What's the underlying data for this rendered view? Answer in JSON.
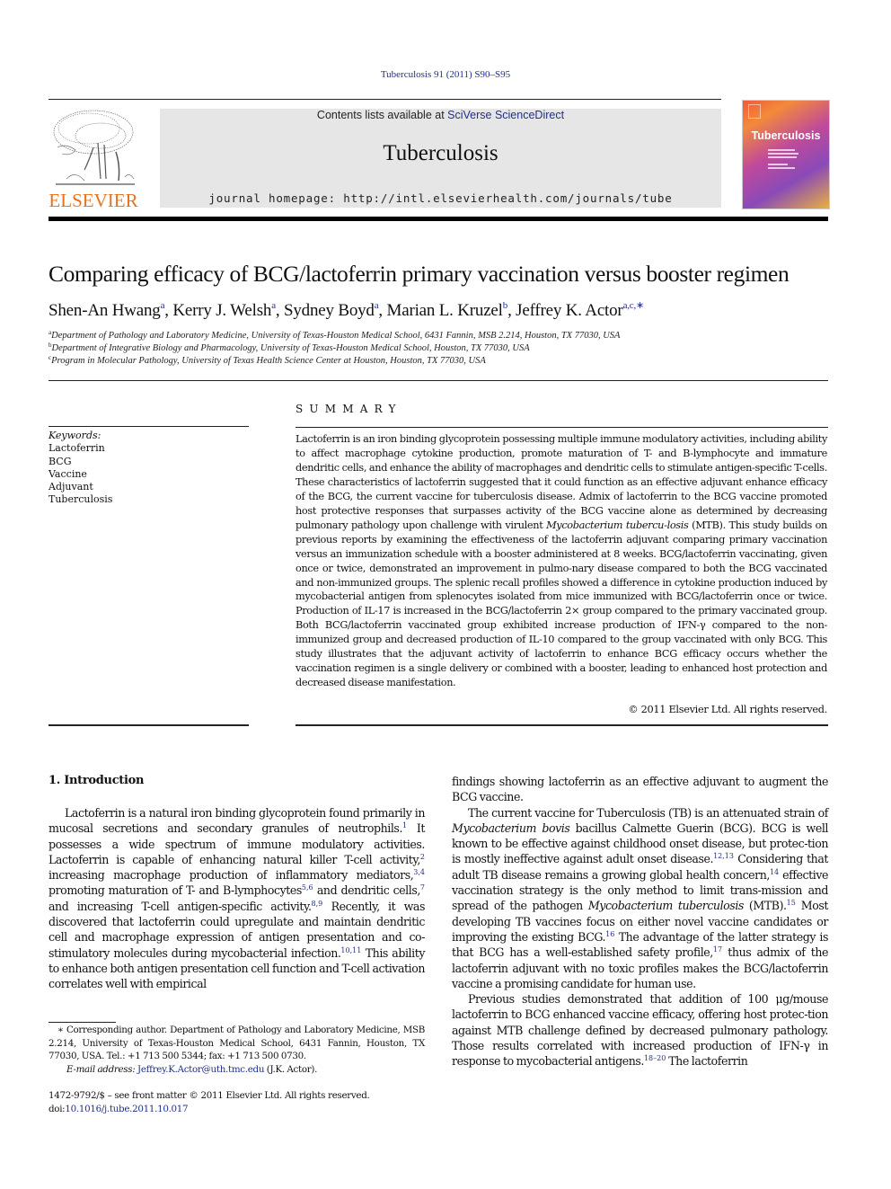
{
  "journal_ref": "Tuberculosis 91 (2011) S90–S95",
  "masthead": {
    "contents_prefix": "Contents lists available at ",
    "contents_link": "SciVerse ScienceDirect",
    "journal_title": "Tuberculosis",
    "homepage": "journal homepage: http://intl.elsevierhealth.com/journals/tube",
    "publisher": "ELSEVIER",
    "cover_title": "Tuberculosis"
  },
  "colors": {
    "link": "#1f2f8a",
    "elsevier_orange": "#e9711c",
    "masthead_bg": "#e6e6e6"
  },
  "article": {
    "title": "Comparing efficacy of BCG/lactoferrin primary vaccination versus booster regimen",
    "authors": [
      {
        "name": "Shen-An Hwang",
        "sup": "a"
      },
      {
        "name": "Kerry J. Welsh",
        "sup": "a"
      },
      {
        "name": "Sydney Boyd",
        "sup": "a"
      },
      {
        "name": "Marian L. Kruzel",
        "sup": "b"
      },
      {
        "name": "Jeffrey K. Actor",
        "sup": "a,c,∗"
      }
    ],
    "affiliations": [
      {
        "sup": "a",
        "text": "Department of Pathology and Laboratory Medicine, University of Texas-Houston Medical School, 6431 Fannin, MSB 2.214, Houston, TX 77030, USA"
      },
      {
        "sup": "b",
        "text": "Department of Integrative Biology and Pharmacology, University of Texas-Houston Medical School, Houston, TX 77030, USA"
      },
      {
        "sup": "c",
        "text": "Program in Molecular Pathology, University of Texas Health Science Center at Houston, Houston, TX 77030, USA"
      }
    ]
  },
  "keywords": {
    "label": "Keywords:",
    "items": [
      "Lactoferrin",
      "BCG",
      "Vaccine",
      "Adjuvant",
      "Tuberculosis"
    ]
  },
  "summary": {
    "heading": "SUMMARY",
    "part1": "Lactoferrin is an iron binding glycoprotein possessing multiple immune modulatory activities, including ability to affect macrophage cytokine production, promote maturation of T- and B-lymphocyte and immature dendritic cells, and enhance the ability of macrophages and dendritic cells to stimulate antigen-specific T-cells. These characteristics of lactoferrin suggested that it could function as an effective adjuvant enhance efficacy of the BCG, the current vaccine for tuberculosis disease. Admix of lactoferrin to the BCG vaccine promoted host protective responses that surpasses activity of the BCG vaccine alone as determined by decreasing pulmonary pathology upon challenge with virulent ",
    "italic1": "Mycobacterium tubercu-losis",
    "part2": " (MTB). This study builds on previous reports by examining the effectiveness of the lactoferrin adjuvant comparing primary vaccination versus an immunization schedule with a booster administered at 8 weeks. BCG/lactoferrin vaccinating, given once or twice, demonstrated an improvement in pulmo-nary disease compared to both the BCG vaccinated and non-immunized groups. The splenic recall profiles showed a difference in cytokine production induced by mycobacterial antigen from splenocytes isolated from mice immunized with BCG/lactoferrin once or twice. Production of IL-17 is increased in the BCG/lactoferrin 2× group compared to the primary vaccinated group. Both BCG/lactoferrin vaccinated group exhibited increase production of IFN-γ compared to the non-immunized group and decreased production of IL-10 compared to the group vaccinated with only BCG. This study illustrates that the adjuvant activity of lactoferrin to enhance BCG efficacy occurs whether the vaccination regimen is a single delivery or combined with a booster, leading to enhanced host protection and decreased disease manifestation.",
    "copyright": "© 2011 Elsevier Ltd. All rights reserved."
  },
  "introduction": {
    "heading": "1.  Introduction",
    "left_p1": [
      {
        "t": "Lactoferrin is a natural iron binding glycoprotein found primarily in mucosal secretions and secondary granules of neutrophils."
      },
      {
        "c": "1"
      },
      {
        "t": " It possesses a wide spectrum of immune modulatory activities. Lactoferrin is capable of enhancing natural killer T-cell activity,"
      },
      {
        "c": "2"
      },
      {
        "t": " increasing macrophage production of inflammatory mediators,"
      },
      {
        "c": "3,4"
      },
      {
        "t": " promoting maturation of T- and B-lymphocytes"
      },
      {
        "c": "5,6"
      },
      {
        "t": " and dendritic cells,"
      },
      {
        "c": "7"
      },
      {
        "t": " and increasing T-cell antigen-specific activity."
      },
      {
        "c": "8,9"
      },
      {
        "t": " Recently, it was discovered that lactoferrin could upregulate and maintain dendritic cell and macrophage expression of antigen presentation and co-stimulatory molecules during mycobacterial infection."
      },
      {
        "c": "10,11"
      },
      {
        "t": " This ability to enhance both antigen presentation cell function and T-cell activation correlates well with empirical"
      }
    ],
    "right_p0": "findings showing lactoferrin as an effective adjuvant to augment the BCG vaccine.",
    "right_p1": [
      {
        "t": "The current vaccine for Tuberculosis (TB) is an attenuated strain of "
      },
      {
        "i": "Mycobacterium bovis"
      },
      {
        "t": " bacillus Calmette Guerin (BCG). BCG is well known to be effective against childhood onset disease, but protec-tion is mostly ineffective against adult onset disease."
      },
      {
        "c": "12,13"
      },
      {
        "t": " Considering that adult TB disease remains a growing global health concern,"
      },
      {
        "c": "14"
      },
      {
        "t": " effective vaccination strategy is the only method to limit trans-mission and spread of the pathogen "
      },
      {
        "i": "Mycobacterium tuberculosis"
      },
      {
        "t": " (MTB)."
      },
      {
        "c": "15"
      },
      {
        "t": " Most developing TB vaccines focus on either novel vaccine candidates or improving the existing BCG."
      },
      {
        "c": "16"
      },
      {
        "t": " The advantage of the latter strategy is that BCG has a well-established safety profile,"
      },
      {
        "c": "17"
      },
      {
        "t": " thus admix of the lactoferrin adjuvant with no toxic profiles makes the BCG/lactoferrin vaccine a promising candidate for human use."
      }
    ],
    "right_p2": [
      {
        "t": "Previous studies demonstrated that addition of 100 μg/mouse lactoferrin to BCG enhanced vaccine efficacy, offering host protec-tion against MTB challenge defined by decreased pulmonary pathology. Those results correlated with increased production of IFN-γ in response to mycobacterial antigens."
      },
      {
        "c": "18–20"
      },
      {
        "t": " The lactoferrin"
      }
    ]
  },
  "footnote": {
    "corresponding": "∗ Corresponding author. Department of Pathology and Laboratory Medicine, MSB 2.214, University of Texas-Houston Medical School, 6431 Fannin, Houston, TX 77030, USA. Tel.: +1 713 500 5344; fax: +1 713 500 0730.",
    "email_label": "E-mail address:",
    "email": "Jeffrey.K.Actor@uth.tmc.edu",
    "email_suffix": " (J.K. Actor)."
  },
  "front_matter": {
    "issn_line": "1472-9792/$ – see front matter © 2011 Elsevier Ltd. All rights reserved.",
    "doi_prefix": "doi:",
    "doi": "10.1016/j.tube.2011.10.017"
  }
}
